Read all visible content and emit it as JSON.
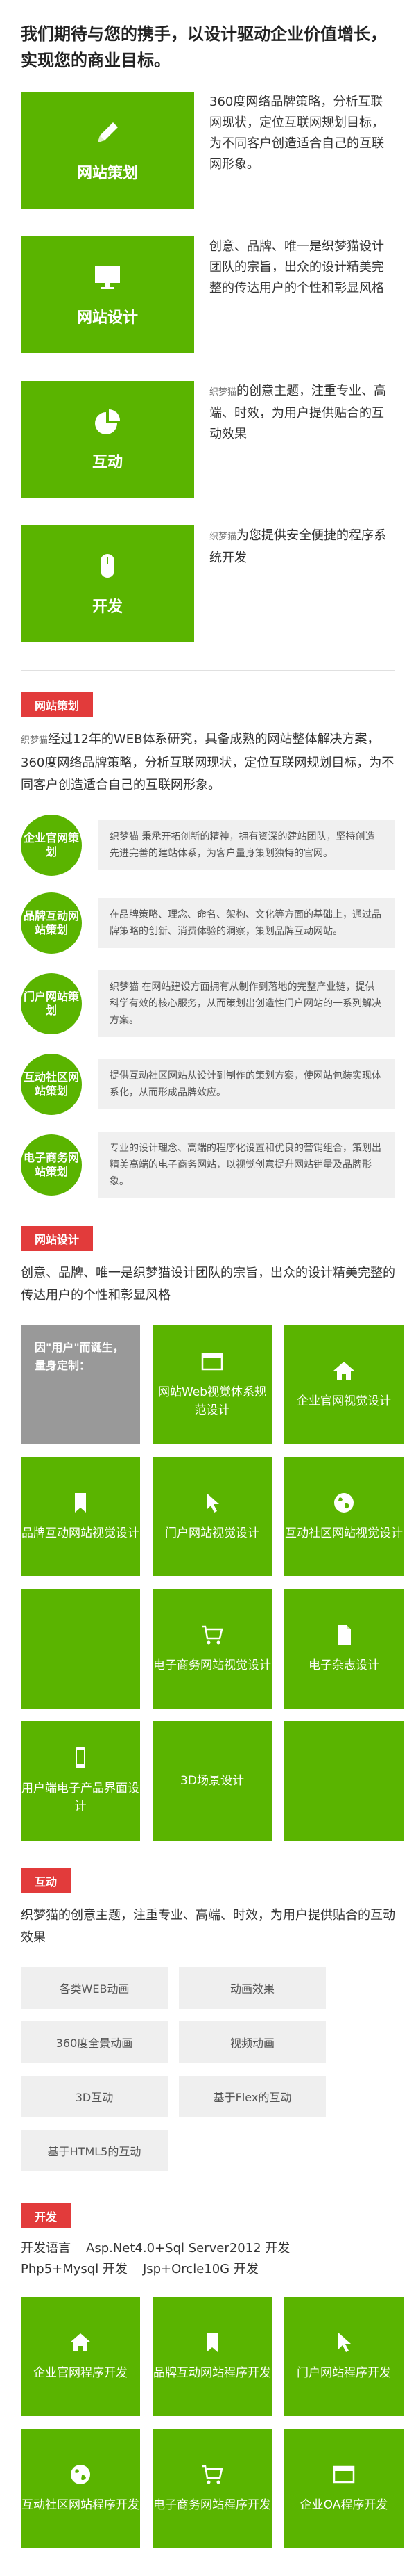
{
  "hero": {
    "title": "我们期待与您的携手，以设计驱动企业价值增长，实现您的商业目标。"
  },
  "services": [
    {
      "icon": "pencil-icon",
      "label": "网站策划",
      "brand": "",
      "text": "360度网络品牌策略，分析互联网现状，定位互联网规划目标，为不同客户创造适合自己的互联网形象。"
    },
    {
      "icon": "monitor-icon",
      "label": "网站设计",
      "brand": "织梦猫",
      "text": "创意、品牌、唯一是织梦猫设计团队的宗旨，出众的设计精美完整的传达用户的个性和彰显风格"
    },
    {
      "icon": "piechart-icon",
      "label": "互动",
      "brand": "织梦猫",
      "text": "的创意主题，注重专业、高端、时效，为用户提供贴合的互动效果"
    },
    {
      "icon": "mouse-icon",
      "label": "开发",
      "brand": "织梦猫",
      "text": "为您提供安全便捷的程序系统开发"
    }
  ],
  "planning": {
    "tag": "网站策划",
    "intro_brand": "织梦猫",
    "intro": "经过12年的WEB体系研究，具备成熟的网站整体解决方案，360度网络品牌策略，分析互联网现状，定位互联网规划目标，为不同客户创造适合自己的互联网形象。",
    "items": [
      {
        "circle": "企业官网策划",
        "text": "织梦猫 秉承开拓创新的精神，拥有资深的建站团队，坚持创造先进完善的建站体系，为客户量身策划独特的官网。"
      },
      {
        "circle": "品牌互动网站策划",
        "text": "在品牌策略、理念、命名、架构、文化等方面的基础上，通过品牌策略的创新、消费体验的洞察，策划品牌互动网站。"
      },
      {
        "circle": "门户网站策划",
        "text": "织梦猫 在网站建设方面拥有从制作到落地的完整产业链，提供科学有效的核心服务，从而策划出创造性门户网站的一系列解决方案。"
      },
      {
        "circle": "互动社区网站策划",
        "text": "提供互动社区网站从设计到制作的策划方案，使网站包装实现体系化，从而形成品牌效应。"
      },
      {
        "circle": "电子商务网站策划",
        "text": "专业的设计理念、高端的程序化设置和优良的营销组合，策划出精美高端的电子商务网站，以视觉创意提升网站销量及品牌形象。"
      }
    ]
  },
  "design": {
    "tag": "网站设计",
    "intro": "创意、品牌、唯一是织梦猫设计团队的宗旨，出众的设计精美完整的传达用户的个性和彰显风格",
    "lead": "因\"用户\"而诞生，量身定制：",
    "cells": [
      {
        "icon": "browser-icon",
        "label": "网站Web视觉体系规范设计"
      },
      {
        "icon": "home-icon",
        "label": "企业官网视觉设计"
      },
      {
        "icon": "bookmark-icon",
        "label": "品牌互动网站视觉设计"
      },
      {
        "icon": "cursor-icon",
        "label": "门户网站视觉设计"
      },
      {
        "icon": "globe-icon",
        "label": "互动社区网站视觉设计"
      },
      {
        "icon": "",
        "label": ""
      },
      {
        "icon": "cart-icon",
        "label": "电子商务网站视觉设计"
      },
      {
        "icon": "document-icon",
        "label": "电子杂志设计"
      },
      {
        "icon": "phone-icon",
        "label": "用户端电子产品界面设计"
      },
      {
        "icon": "",
        "label": "3D场景设计"
      },
      {
        "icon": "",
        "label": ""
      }
    ]
  },
  "interaction": {
    "tag": "互动",
    "intro": "织梦猫的创意主题，注重专业、高端、时效，为用户提供贴合的互动效果",
    "tags": [
      "各类WEB动画",
      "动画效果",
      "360度全景动画",
      "视频动画",
      "3D互动",
      "基于Flex的互动",
      "基于HTML5的互动"
    ]
  },
  "development": {
    "tag": "开发",
    "langs": [
      "开发语言",
      "Asp.Net4.0+Sql Server2012 开发",
      "Php5+Mysql 开发",
      "Jsp+Orcle10G 开发"
    ],
    "cells": [
      {
        "icon": "home-icon",
        "label": "企业官网程序开发"
      },
      {
        "icon": "bookmark-icon",
        "label": "品牌互动网站程序开发"
      },
      {
        "icon": "cursor-icon",
        "label": "门户网站程序开发"
      },
      {
        "icon": "globe-icon",
        "label": "互动社区网站程序开发"
      },
      {
        "icon": "cart-icon",
        "label": "电子商务网站程序开发"
      },
      {
        "icon": "browser-icon",
        "label": "企业OA程序开发"
      }
    ]
  },
  "colors": {
    "green": "#5ab400",
    "red": "#e23b3b",
    "grey": "#999999"
  }
}
